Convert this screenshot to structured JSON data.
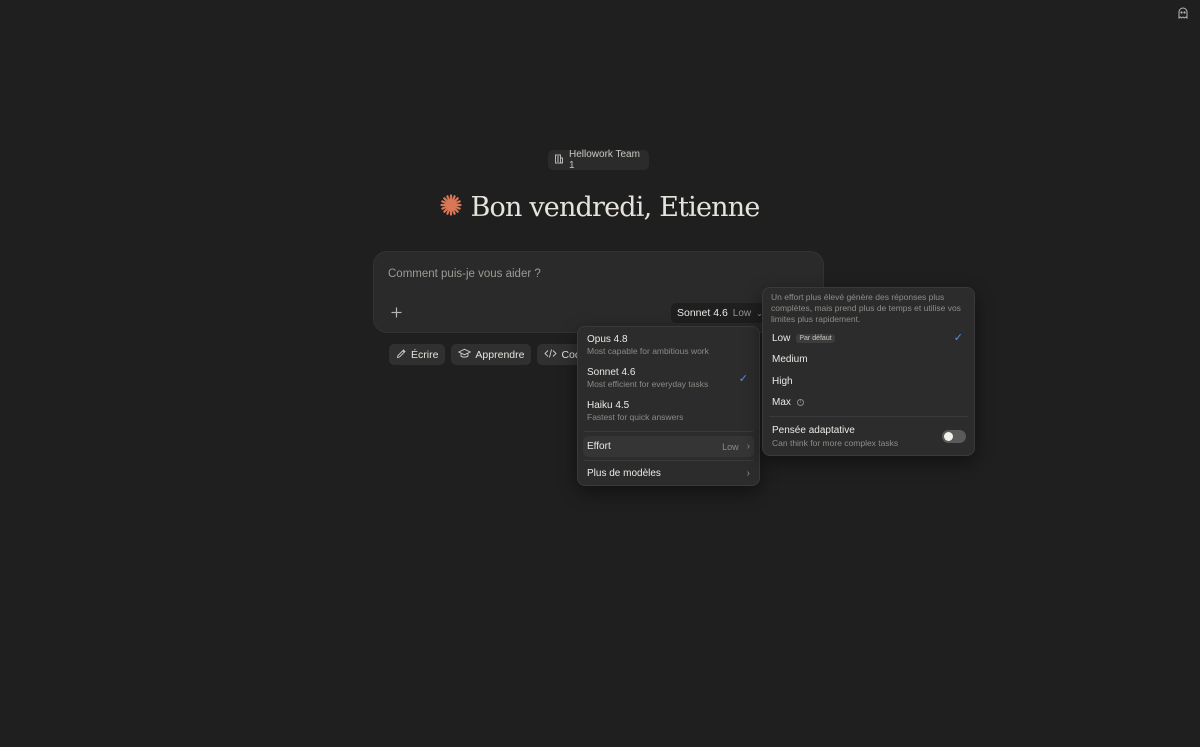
{
  "workspace": {
    "name": "Hellowork Team 1"
  },
  "greeting": {
    "text": "Bon vendredi, Etienne"
  },
  "composer": {
    "placeholder": "Comment puis-je vous aider ?",
    "model_label": "Sonnet 4.6",
    "effort_label": "Low"
  },
  "chips": [
    {
      "label": "Écrire",
      "icon": "pencil-icon"
    },
    {
      "label": "Apprendre",
      "icon": "graduation-cap-icon"
    },
    {
      "label": "Code",
      "icon": "code-icon"
    }
  ],
  "model_menu": {
    "models": [
      {
        "name": "Opus 4.8",
        "desc": "Most capable for ambitious work",
        "selected": false
      },
      {
        "name": "Sonnet 4.6",
        "desc": "Most efficient for everyday tasks",
        "selected": true
      },
      {
        "name": "Haiku 4.5",
        "desc": "Fastest for quick answers",
        "selected": false
      }
    ],
    "effort_label": "Effort",
    "effort_value": "Low",
    "more_models": "Plus de modèles"
  },
  "effort_panel": {
    "description": "Un effort plus élevé génère des réponses plus complètes, mais prend plus de temps et utilise vos limites plus rapidement.",
    "options": [
      {
        "label": "Low",
        "badge": "Par défaut",
        "selected": true
      },
      {
        "label": "Medium"
      },
      {
        "label": "High"
      },
      {
        "label": "Max"
      }
    ],
    "adaptive_title": "Pensée adaptative",
    "adaptive_desc": "Can think for more complex tasks",
    "adaptive_enabled": false
  },
  "colors": {
    "background": "#1f1f1f",
    "accent_star": "#d97757",
    "check": "#5b8ee6"
  }
}
